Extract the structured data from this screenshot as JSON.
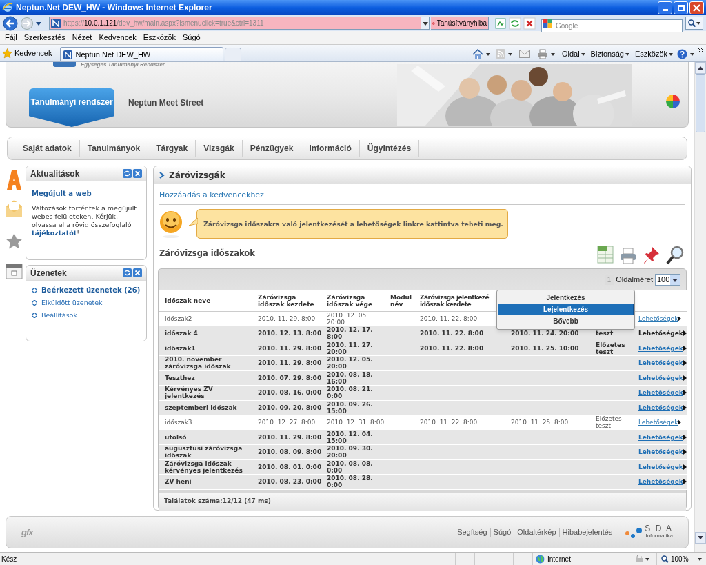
{
  "window": {
    "title": "Neptun.Net DEW_HW - Windows Internet Explorer"
  },
  "address_bar": {
    "url_scheme": "https://",
    "url_host": "10.0.1.121",
    "url_path": "/dev_hw/main.aspx?ismenuclick=true&ctrl=1311",
    "certificate_error": "Tanúsítványhiba"
  },
  "search": {
    "placeholder": "Google"
  },
  "menu": [
    "Fájl",
    "Szerkesztés",
    "Nézet",
    "Kedvencek",
    "Eszközök",
    "Súgó"
  ],
  "favorites": {
    "label": "Kedvencek"
  },
  "tabs": [
    {
      "label": "Neptun.Net DEW_HW",
      "selected": true
    }
  ],
  "command_bar": [
    "Oldal",
    "Biztonság",
    "Eszközök"
  ],
  "header": {
    "subtitle": "Egységes Tanulmányi Rendszer",
    "tabs": [
      {
        "label": "Tanulmányi rendszer",
        "selected": true
      },
      {
        "label": "Neptun Meet Street",
        "selected": false
      }
    ]
  },
  "nav": [
    "Saját adatok",
    "Tanulmányok",
    "Tárgyak",
    "Vizsgák",
    "Pénzügyek",
    "Információ",
    "Ügyintézés"
  ],
  "news_panel": {
    "title": "Aktualitások",
    "headline": "Megújult a web",
    "text": "Változások történtek a megújult webes felületeken. Kérjük, olvassa el a rövid összefoglaló ",
    "link": "tájékoztatót",
    "text_end": "!"
  },
  "messages_panel": {
    "title": "Üzenetek",
    "items": [
      {
        "label": "Beérkezett üzenetek (26)",
        "unread": true
      },
      {
        "label": "Elküldött üzenetek",
        "unread": false
      },
      {
        "label": "Beállítások",
        "unread": false
      }
    ]
  },
  "main": {
    "title": "Záróvizsgák",
    "favorite_link": "Hozzáadás a kedvencekhez",
    "hint": "Záróvizsga időszakra való jelentkezését a lehetőségek linkre kattintva teheti meg.",
    "section_title": "Záróvizsga időszakok",
    "pager": {
      "page": "1",
      "page_size_label": "Oldalméret",
      "page_size": "100"
    },
    "columns": [
      {
        "lines": [
          "Időszak neve"
        ]
      },
      {
        "lines": [
          "Záróvizsga",
          "időszak kezdete"
        ]
      },
      {
        "lines": [
          "Záróvizsga",
          "időszak vége"
        ]
      },
      {
        "lines": [
          "Modul",
          "név"
        ]
      },
      {
        "lines": [
          "Záróvizsga jelentkezé",
          "időszak kezdete"
        ]
      }
    ],
    "rows": [
      {
        "name": "időszak2",
        "start": "2010. 11. 29. 8:00",
        "end": "2010. 12. 05. 20:00",
        "reg_start": "2010. 11. 22. 8:00",
        "link": "Lehetőségek",
        "bold": false,
        "hovered": false
      },
      {
        "name": "időszak 4",
        "start": "2010. 12. 13. 8:00",
        "end": "2010. 12. 17. 8:00",
        "reg_start": "2010. 11. 22. 8:00",
        "reg_end": "2010. 11. 24. 20:00",
        "note": "teszt",
        "link": "Lehetőségek",
        "bold": true,
        "hovered": true
      },
      {
        "name": "időszak1",
        "start": "2010. 11. 29. 8:00",
        "end": "2010. 11. 27. 20:00",
        "reg_start": "2010. 11. 22. 8:00",
        "reg_end": "2010. 11. 25. 10:00",
        "note": "Előzetes teszt",
        "link": "Lehetőségek",
        "bold": true,
        "hovered": false
      },
      {
        "name": "2010. november záróvizsga időszak",
        "start": "2010. 11. 29. 8:00",
        "end": "2010. 12. 05. 20:00",
        "link": "Lehetőségek",
        "bold": true,
        "hovered": false
      },
      {
        "name": "Teszthez",
        "start": "2010. 07. 29. 8:00",
        "end": "2010. 08. 18. 16:00",
        "link": "Lehetőségek",
        "bold": true,
        "hovered": false
      },
      {
        "name": "Kérvényes ZV jelentkezés",
        "start": "2010. 08. 16. 0:00",
        "end": "2010. 08. 21. 0:00",
        "link": "Lehetőségek",
        "bold": true,
        "hovered": false
      },
      {
        "name": "szeptemberi időszak",
        "start": "2010. 09. 20. 8:00",
        "end": "2010. 09. 26. 15:00",
        "link": "Lehetőségek",
        "bold": true,
        "hovered": false
      },
      {
        "name": "időszak3",
        "start": "2010. 12. 27. 8:00",
        "end": "2010. 12. 31. 8:00",
        "reg_start": "2010. 11. 22. 8:00",
        "reg_end": "2010. 11. 25. 8:00",
        "note": "Előzetes teszt",
        "link": "Lehetőségek",
        "bold": false,
        "hovered": false
      },
      {
        "name": "utolsó",
        "start": "2010. 11. 29. 8:00",
        "end": "2010. 12. 04. 15:00",
        "link": "Lehetőségek",
        "bold": true,
        "hovered": false
      },
      {
        "name": "augusztusi záróvizsga időszak",
        "start": "2010. 08. 09. 8:00",
        "end": "2010. 09. 30. 20:00",
        "link": "Lehetőségek",
        "bold": true,
        "hovered": false
      },
      {
        "name": "Záróvizsga időszak kérvényes jelentkezés",
        "start": "2010. 08. 01. 0:00",
        "end": "2010. 08. 08. 0:00",
        "link": "Lehetőségek",
        "bold": true,
        "hovered": false
      },
      {
        "name": "ZV heni",
        "start": "2010. 08. 23. 0:00",
        "end": "2010. 08. 28. 0:00",
        "link": "Lehetőségek",
        "bold": true,
        "hovered": false
      }
    ],
    "context_menu": [
      {
        "label": "Jelentkezés",
        "selected": false
      },
      {
        "label": "Lejelentkezés",
        "selected": true
      },
      {
        "label": "Bővebb",
        "selected": false
      }
    ],
    "result_count": "Találatok száma:12/12 (47 ms)"
  },
  "footer": {
    "logo": "gfx",
    "links": [
      "Segítség",
      "Súgó",
      "Oldaltérkép",
      "Hibabejelentés"
    ],
    "brand": "S D A",
    "brand_sub": "Informatika"
  },
  "status_bar": {
    "text": "Kész",
    "zone": "Internet",
    "zoom": "100%"
  }
}
